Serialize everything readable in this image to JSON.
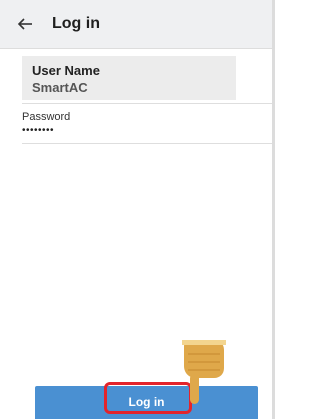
{
  "header": {
    "title": "Log in",
    "back_icon": "arrow-left-icon"
  },
  "form": {
    "user_name_label": "User Name",
    "user_name_value": "SmartAC",
    "password_label": "Password",
    "password_value": "••••••••"
  },
  "actions": {
    "login_label": "Log in"
  },
  "colors": {
    "app_bar_bg": "#eff0f2",
    "button_bg": "#4a90d2",
    "highlight": "#e3242b",
    "hand": "#dfa84a"
  },
  "overlay": {
    "pointer_icon": "pointing-hand-icon"
  }
}
